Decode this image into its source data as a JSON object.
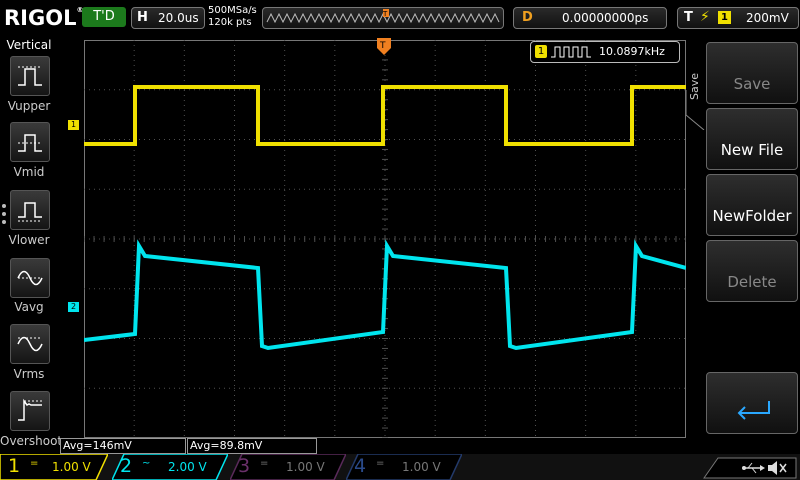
{
  "header": {
    "logo": "RIGOL",
    "trigger_state": "T'D",
    "horizontal_key": "H",
    "timebase": "20.0us",
    "sample_rate": "500MSa/s",
    "memory_depth": "120k pts",
    "delay_key": "D",
    "delay": "0.00000000ps",
    "trigger_key": "T",
    "trigger_channel": "1",
    "trigger_level": "200mV"
  },
  "left_menu": {
    "title": "Vertical",
    "items": [
      {
        "label": "Vupper",
        "icon": "vupper-icon"
      },
      {
        "label": "Vmid",
        "icon": "vmid-icon"
      },
      {
        "label": "Vlower",
        "icon": "vlower-icon"
      },
      {
        "label": "Vavg",
        "icon": "vavg-icon"
      },
      {
        "label": "Vrms",
        "icon": "vrms-icon"
      },
      {
        "label": "Overshoot",
        "icon": "overshoot-icon"
      }
    ]
  },
  "right_menu": {
    "title": "Save",
    "buttons": [
      {
        "label": "Save",
        "enabled": false
      },
      {
        "label": "New File",
        "enabled": true
      },
      {
        "label": "NewFolder",
        "enabled": true
      },
      {
        "label": "Delete",
        "enabled": false
      },
      {
        "label": "",
        "icon": "return-arrow-icon",
        "enabled": true
      }
    ]
  },
  "frequency_counter": {
    "channel": "1",
    "value": "10.0897kHz"
  },
  "channel_markers": {
    "ch1": "1",
    "ch2": "2"
  },
  "measurements": [
    {
      "text": "Avg=146mV",
      "color": "#f0e000"
    },
    {
      "text": "Avg=89.8mV",
      "color": "#00e5ee"
    }
  ],
  "channels": [
    {
      "num": "1",
      "coupling": "=",
      "scale": "1.00 V",
      "color": "#f0e000",
      "active": true
    },
    {
      "num": "2",
      "coupling": "~",
      "scale": "2.00 V",
      "color": "#00e5ee",
      "active": true
    },
    {
      "num": "3",
      "coupling": "=",
      "scale": "1.00 V",
      "color": "#d040d0",
      "active": false
    },
    {
      "num": "4",
      "coupling": "=",
      "scale": "1.00 V",
      "color": "#3070ff",
      "active": false
    }
  ],
  "colors": {
    "ch1": "#f0e000",
    "ch2": "#00e5ee",
    "trigger": "#f08020",
    "grid": "#505050"
  },
  "status_icons": [
    "usb-icon",
    "speaker-mute-icon"
  ]
}
